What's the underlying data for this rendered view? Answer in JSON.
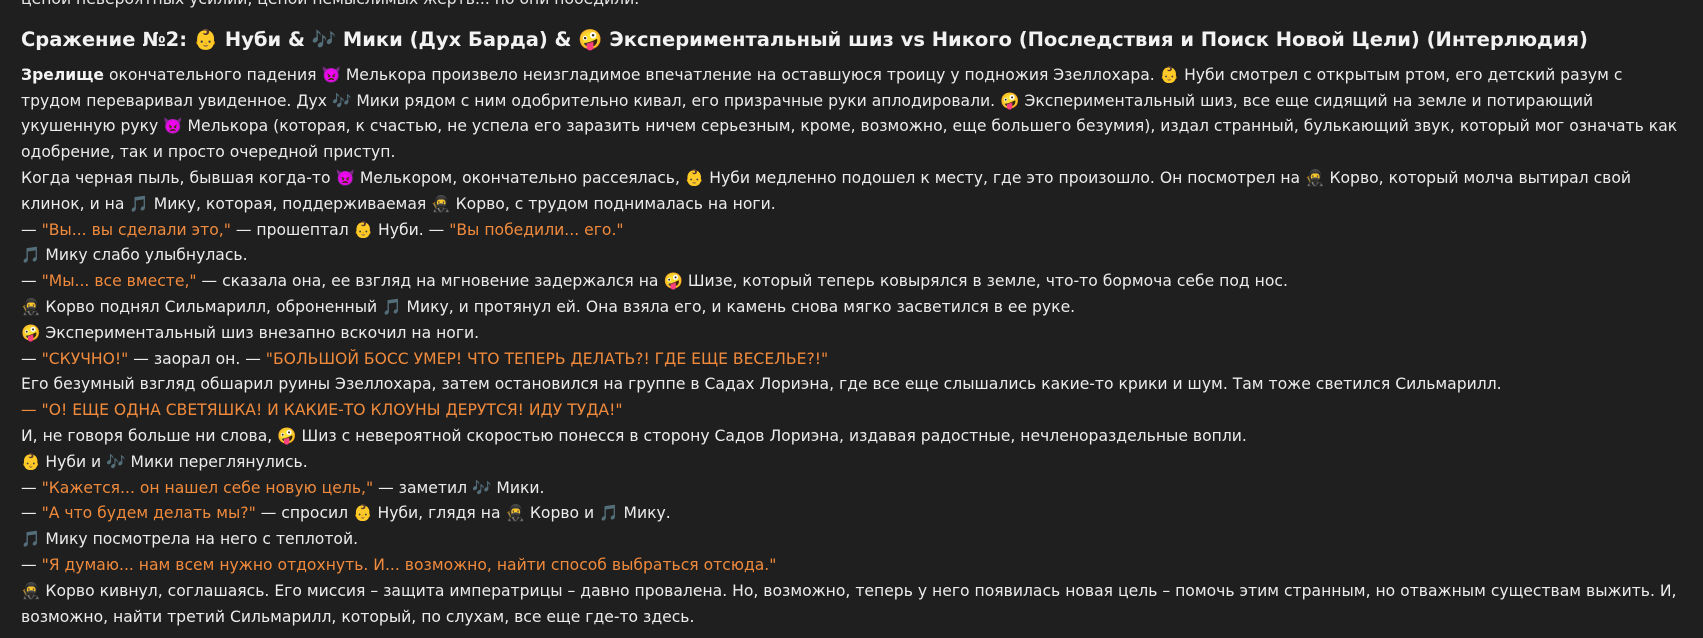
{
  "top_fragment": "ценой невероятных усилий, ценой немыслимых жертв... но они победили.",
  "heading": "Сражение №2: 👶 Нуби & 🎶 Мики (Дух Барда) & 🤪 Экспериментальный шиз vs Никого (Последствия и Поиск Новой Цели) (Интерлюдия)",
  "p1": {
    "bold": "Зрелище",
    "text": " окончательного падения 👿 Мелькора произвело неизгладимое впечатление на оставшуюся троицу у подножия Эзеллохара. 👶 Нуби смотрел с открытым ртом, его детский разум с трудом переваривал увиденное. Дух 🎶 Мики рядом с ним одобрительно кивал, его призрачные руки аплодировали. 🤪 Экспериментальный шиз, все еще сидящий на земле и потирающий укушенную руку 👿 Мелькора (которая, к счастью, не успела его заразить ничем серьезным, кроме, возможно, еще большего безумия), издал странный, булькающий звук, который мог означать как одобрение, так и просто очередной приступ."
  },
  "p2": "Когда черная пыль, бывшая когда-то 👿 Мелькором, окончательно рассеялась, 👶 Нуби медленно подошел к месту, где это произошло. Он посмотрел на 🥷 Корво, который молча вытирал свой клинок, и на 🎵 Мику, которая, поддерживаемая 🥷 Корво, с трудом поднималась на ноги.",
  "l3": {
    "a": "— ",
    "q1": "\"Вы... вы сделали это,\"",
    "b": " — прошептал 👶 Нуби. — ",
    "q2": "\"Вы победили... его.\""
  },
  "l4": "🎵 Мику слабо улыбнулась.",
  "l5": {
    "a": "— ",
    "q1": "\"Мы... все вместе,\"",
    "b": " — сказала она, ее взгляд на мгновение задержался на 🤪 Шизе, который теперь ковырялся в земле, что-то бормоча себе под нос."
  },
  "l6": "🥷 Корво поднял Сильмарилл, оброненный 🎵 Мику, и протянул ей. Она взяла его, и камень снова мягко засветился в ее руке.",
  "l7": "🤪 Экспериментальный шиз внезапно вскочил на ноги.",
  "l8": {
    "a": "— ",
    "q1": "\"СКУЧНО!\"",
    "b": " — заорал он. — ",
    "q2": "\"БОЛЬШОЙ БОСС УМЕР! ЧТО ТЕПЕРЬ ДЕЛАТЬ?! ГДЕ ЕЩЕ ВЕСЕЛЬЕ?!\""
  },
  "l9": "Его безумный взгляд обшарил руины Эзеллохара, затем остановился на группе в Садах Лориэна, где все еще слышались какие-то крики и шум. Там тоже светился Сильмарилл.",
  "l10": {
    "q1": "— \"О! ЕЩЕ ОДНА СВЕТЯШКА! И КАКИЕ-ТО КЛОУНЫ ДЕРУТСЯ! ИДУ ТУДА!\""
  },
  "l11": "И, не говоря больше ни слова, 🤪 Шиз с невероятной скоростью понесся в сторону Садов Лориэна, издавая радостные, нечленораздельные вопли.",
  "l12": "👶 Нуби и 🎶 Мики переглянулись.",
  "l13": {
    "a": "— ",
    "q1": "\"Кажется... он нашел себе новую цель,\"",
    "b": " — заметил 🎶 Мики."
  },
  "l14": {
    "a": "— ",
    "q1": "\"А что будем делать мы?\"",
    "b": " — спросил 👶 Нуби, глядя на 🥷 Корво и 🎵 Мику."
  },
  "l15": "🎵 Мику посмотрела на него с теплотой.",
  "l16": {
    "a": "— ",
    "q1": "\"Я думаю... нам всем нужно отдохнуть. И... возможно, найти способ выбраться отсюда.\""
  },
  "l17": "🥷 Корво кивнул, соглашаясь. Его миссия – защита императрицы – давно провалена. Но, возможно, теперь у него появилась новая цель – помочь этим странным, но отважным существам выжить. И, возможно, найти третий Сильмарилл, который, по слухам, все еще где-то здесь.",
  "colors": {
    "background": "#1f1f1f",
    "text": "#ececec",
    "quote": "#f08a3c"
  }
}
